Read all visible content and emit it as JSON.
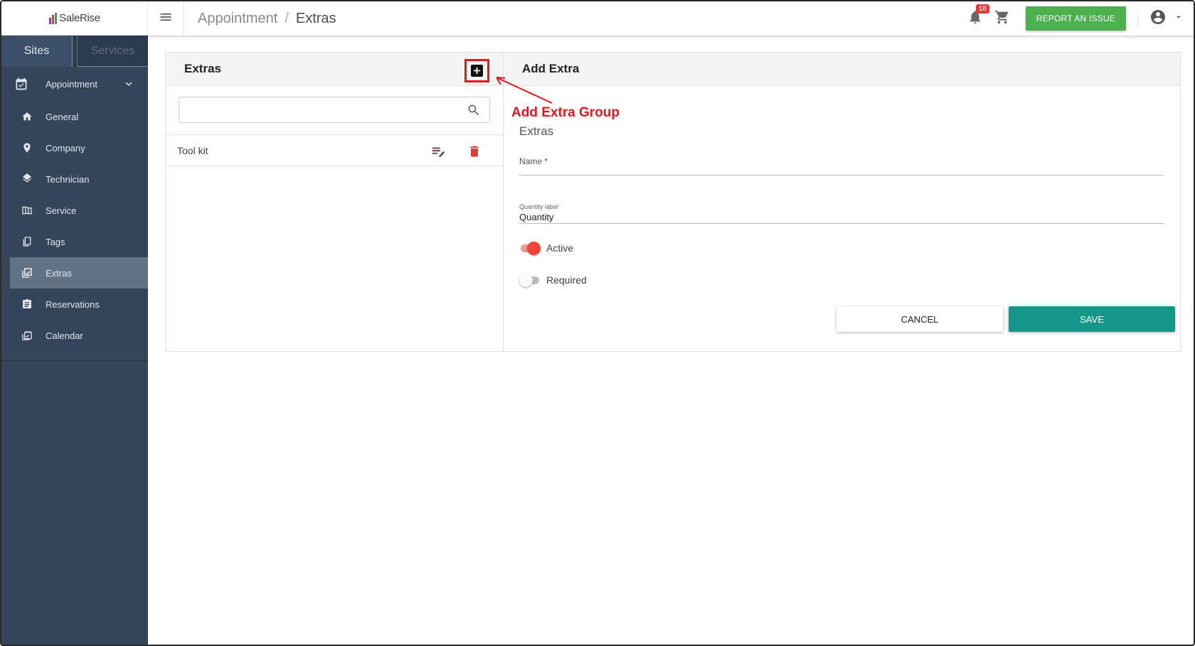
{
  "app": {
    "logo_text": "SaleRise"
  },
  "sidebar": {
    "tabs": [
      {
        "label": "Sites"
      },
      {
        "label": "Services"
      }
    ],
    "parent": {
      "label": "Appointment",
      "icon": "calendar-check-icon"
    },
    "items": [
      {
        "label": "General",
        "icon": "home-icon"
      },
      {
        "label": "Company",
        "icon": "location-pin-icon"
      },
      {
        "label": "Technician",
        "icon": "layers-icon"
      },
      {
        "label": "Service",
        "icon": "book-icon"
      },
      {
        "label": "Tags",
        "icon": "tag-copy-icon"
      },
      {
        "label": "Extras",
        "icon": "collection-icon"
      },
      {
        "label": "Reservations",
        "icon": "clipboard-icon"
      },
      {
        "label": "Calendar",
        "icon": "calendar-icon"
      }
    ]
  },
  "header": {
    "breadcrumb_parent": "Appointment",
    "breadcrumb_sep": "/",
    "breadcrumb_current": "Extras",
    "notification_count": "18",
    "report_button": "REPORT AN ISSUE"
  },
  "extras_panel": {
    "title": "Extras",
    "search_placeholder": "",
    "items": [
      {
        "name": "Tool kit"
      }
    ]
  },
  "form_panel": {
    "title": "Add Extra",
    "section_title": "Extras",
    "name_label": "Name *",
    "name_value": "",
    "quantity_label": "Quantity label",
    "quantity_value": "Quantity",
    "active_label": "Active",
    "active_on": true,
    "required_label": "Required",
    "required_on": false,
    "cancel_button": "CANCEL",
    "save_button": "SAVE"
  },
  "annotation": {
    "text": "Add Extra Group",
    "color": "#e8151b"
  },
  "colors": {
    "sidebar_bg": "#34455a",
    "active_item_bg": "#617385",
    "report_green": "#4caf50",
    "save_teal": "#17978a",
    "delete_red": "#e53935",
    "toggle_red": "#f44336"
  }
}
